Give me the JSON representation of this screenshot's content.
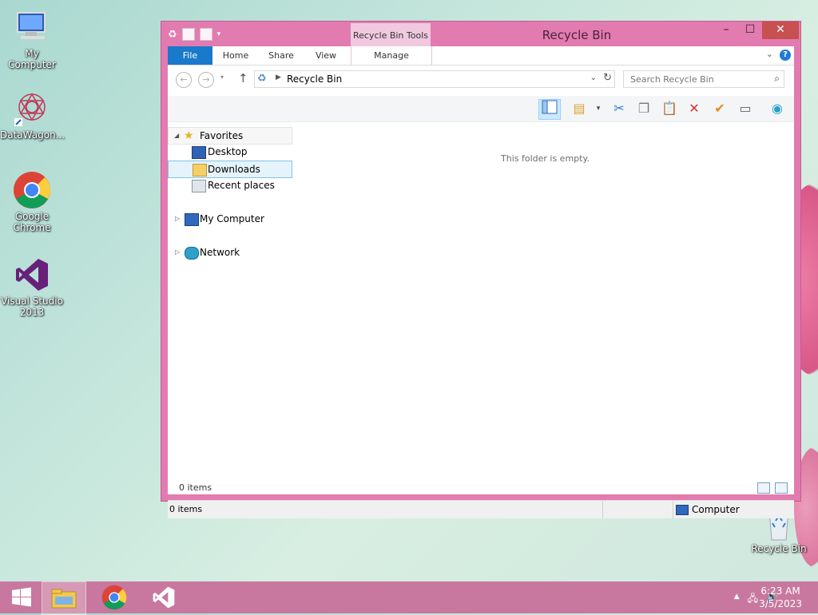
{
  "desktop": {
    "icons": [
      {
        "label": "My Computer",
        "icon": "computer-icon"
      },
      {
        "label": "DataWagon...",
        "icon": "datawagon-icon"
      },
      {
        "label": "Google Chrome",
        "icon": "chrome-icon"
      },
      {
        "label": "Visual Studio 2013",
        "icon": "visual-studio-icon"
      },
      {
        "label": "Recycle Bin",
        "icon": "recycle-bin-icon"
      }
    ]
  },
  "window": {
    "title": "Recycle Bin",
    "context_tab": "Recycle Bin Tools",
    "controls": {
      "minimize": "–",
      "maximize": "☐",
      "close": "✕"
    },
    "ribbon_tabs": [
      "File",
      "Home",
      "Share",
      "View",
      "Manage"
    ],
    "address": {
      "path": "Recycle Bin"
    },
    "search": {
      "placeholder": "Search Recycle Bin"
    },
    "nav": {
      "favorites": "Favorites",
      "desktop": "Desktop",
      "downloads": "Downloads",
      "recent": "Recent places",
      "my_computer": "My Computer",
      "network": "Network"
    },
    "empty_message": "This folder is empty.",
    "item_count": "0 items",
    "status": {
      "left": "0 items",
      "right": "Computer"
    }
  },
  "taskbar": {
    "time": "6:23 AM",
    "date": "3/5/2023"
  },
  "colors": {
    "window_frame": "#e27bb0",
    "taskbar": "#c8789e",
    "file_tab": "#1979ca",
    "selection": "#e5f3fb"
  }
}
